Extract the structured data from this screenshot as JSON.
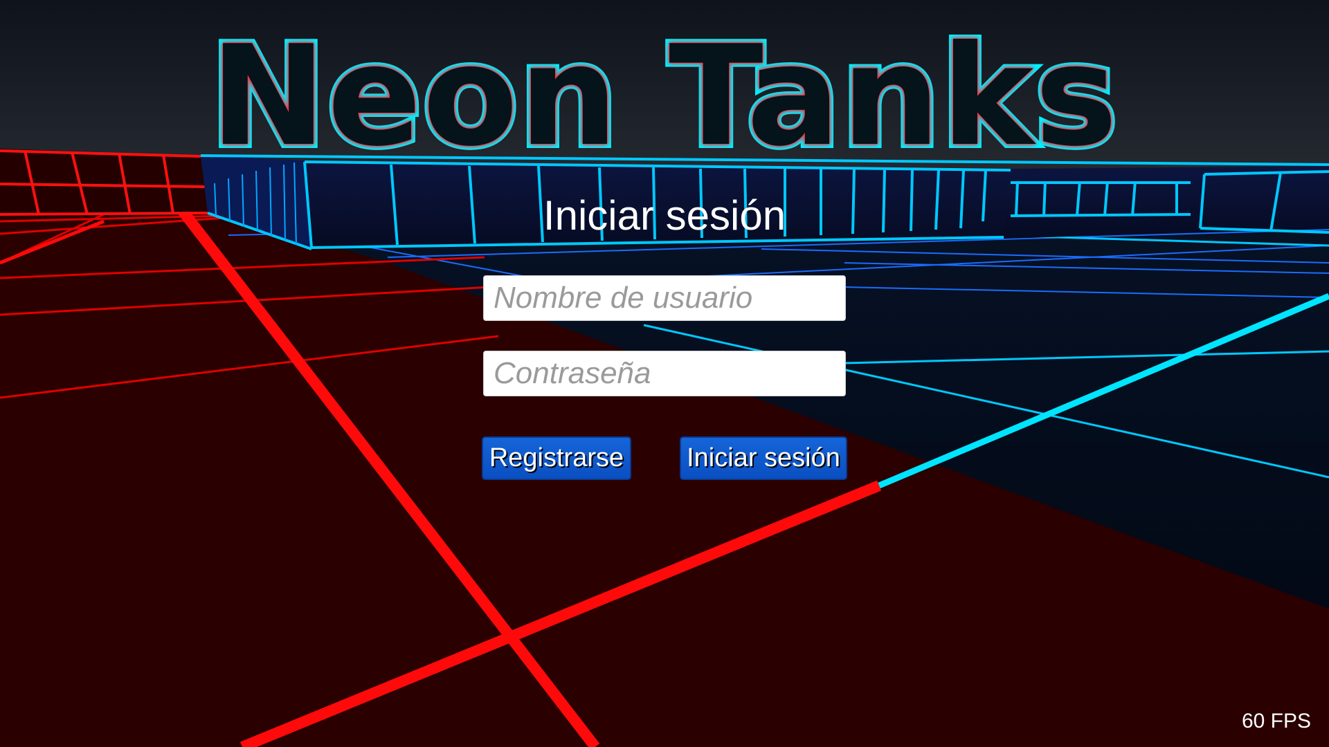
{
  "title": "Neon Tanks",
  "login": {
    "heading": "Iniciar sesión",
    "username_placeholder": "Nombre de usuario",
    "password_placeholder": "Contraseña",
    "register_label": "Registrarse",
    "login_label": "Iniciar sesión"
  },
  "hud": {
    "fps": "60 FPS"
  },
  "colors": {
    "sky": "#10161f",
    "red_floor": "#2a0000",
    "red_line": "#ff0a0a",
    "blue_floor": "#010814",
    "cyan_line": "#00d8ff",
    "blue_line": "#1a6cff",
    "wall_fill": "#0a1030",
    "title_stroke": "#00f0ff",
    "title_glow": "#ff2a3a",
    "button": "#0d56c8"
  }
}
